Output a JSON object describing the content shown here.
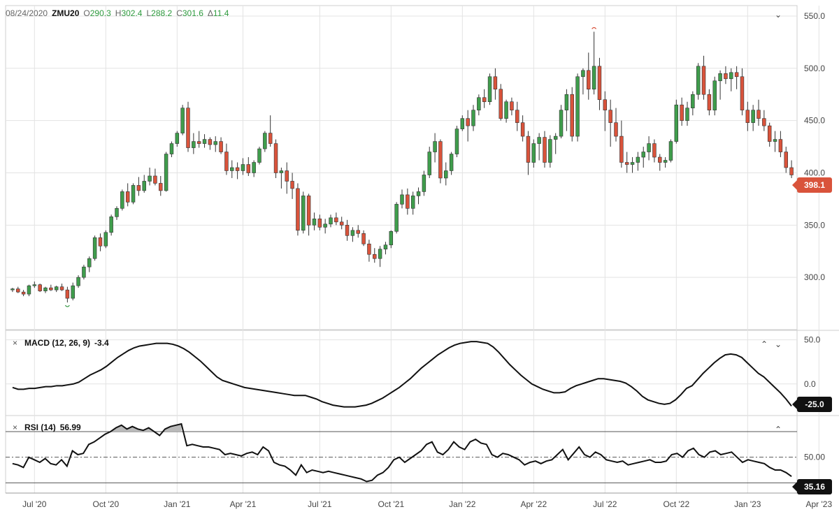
{
  "header": {
    "date": "08/24/2020",
    "symbol": "ZMU20",
    "open_label": "O",
    "open": "290.3",
    "high_label": "H",
    "high": "302.4",
    "low_label": "L",
    "low": "288.2",
    "close_label": "C",
    "close": "301.6",
    "change_label": "Δ",
    "change": "11.4"
  },
  "indicators": {
    "macd_label": "MACD (12, 26, 9)",
    "macd_value": "-3.4",
    "rsi_label": "RSI (14)",
    "rsi_value": "56.99"
  },
  "tags": {
    "last_price": "398.1",
    "macd_last": "-25.0",
    "rsi_last": "35.16"
  },
  "icons": {
    "close": "×",
    "collapse": "⌃",
    "expand": "⌄"
  },
  "colors": {
    "up": "#3f9d4c",
    "down": "#d9533b",
    "line": "#111111",
    "grid": "#e3e3e3",
    "rsi_fill": "#b9b9b9"
  },
  "chart_data": [
    {
      "type": "candlestick",
      "ylim": [
        250,
        560
      ],
      "yticks": [
        "550.0",
        "500.0",
        "450.0",
        "400.0",
        "350.0",
        "300.0"
      ],
      "ytick_values": [
        550,
        500,
        450,
        400,
        350,
        300
      ],
      "x_tick_labels": [
        "Jul '20",
        "Oct '20",
        "Jan '21",
        "Apr '21",
        "Jul '21",
        "Oct '21",
        "Jan '22",
        "Apr '22",
        "Jul '22",
        "Oct '22",
        "Jan '23",
        "Apr '23"
      ],
      "x_tick_index": [
        4,
        17,
        30,
        42,
        56,
        69,
        82,
        95,
        108,
        121,
        134,
        147
      ],
      "ohlc": [
        [
          288,
          290,
          286,
          289
        ],
        [
          289,
          291,
          285,
          286
        ],
        [
          286,
          288,
          282,
          284
        ],
        [
          284,
          293,
          282,
          292
        ],
        [
          292,
          296,
          290,
          293
        ],
        [
          293,
          294,
          286,
          287
        ],
        [
          287,
          291,
          285,
          290
        ],
        [
          290,
          293,
          287,
          288
        ],
        [
          288,
          292,
          286,
          291
        ],
        [
          291,
          294,
          287,
          288
        ],
        [
          288,
          291,
          276,
          280
        ],
        [
          280,
          295,
          278,
          292
        ],
        [
          292,
          302,
          290,
          300
        ],
        [
          300,
          312,
          298,
          310
        ],
        [
          310,
          320,
          305,
          318
        ],
        [
          318,
          340,
          316,
          338
        ],
        [
          338,
          342,
          325,
          330
        ],
        [
          330,
          345,
          328,
          343
        ],
        [
          343,
          360,
          340,
          358
        ],
        [
          358,
          368,
          355,
          366
        ],
        [
          366,
          384,
          364,
          382
        ],
        [
          382,
          390,
          368,
          372
        ],
        [
          372,
          390,
          370,
          388
        ],
        [
          388,
          396,
          378,
          383
        ],
        [
          383,
          398,
          381,
          392
        ],
        [
          392,
          405,
          388,
          397
        ],
        [
          397,
          404,
          388,
          390
        ],
        [
          390,
          397,
          378,
          383
        ],
        [
          383,
          420,
          382,
          418
        ],
        [
          418,
          430,
          415,
          428
        ],
        [
          428,
          440,
          425,
          438
        ],
        [
          438,
          465,
          436,
          462
        ],
        [
          462,
          468,
          420,
          424
        ],
        [
          424,
          438,
          418,
          430
        ],
        [
          430,
          440,
          424,
          428
        ],
        [
          428,
          437,
          424,
          432
        ],
        [
          432,
          434,
          422,
          427
        ],
        [
          427,
          435,
          420,
          430
        ],
        [
          430,
          434,
          418,
          420
        ],
        [
          420,
          428,
          398,
          402
        ],
        [
          402,
          412,
          395,
          405
        ],
        [
          405,
          410,
          394,
          402
        ],
        [
          402,
          414,
          398,
          408
        ],
        [
          408,
          415,
          397,
          400
        ],
        [
          400,
          412,
          396,
          410
        ],
        [
          410,
          425,
          408,
          423
        ],
        [
          423,
          440,
          420,
          438
        ],
        [
          438,
          455,
          425,
          428
        ],
        [
          428,
          432,
          395,
          400
        ],
        [
          400,
          405,
          385,
          402
        ],
        [
          402,
          410,
          380,
          392
        ],
        [
          392,
          400,
          375,
          385
        ],
        [
          385,
          390,
          340,
          345
        ],
        [
          345,
          382,
          342,
          378
        ],
        [
          378,
          380,
          340,
          350
        ],
        [
          350,
          362,
          345,
          356
        ],
        [
          356,
          360,
          345,
          348
        ],
        [
          348,
          356,
          342,
          351
        ],
        [
          351,
          360,
          348,
          357
        ],
        [
          357,
          362,
          350,
          353
        ],
        [
          353,
          358,
          346,
          350
        ],
        [
          350,
          355,
          335,
          340
        ],
        [
          340,
          348,
          334,
          345
        ],
        [
          345,
          350,
          338,
          342
        ],
        [
          342,
          345,
          330,
          332
        ],
        [
          332,
          336,
          315,
          322
        ],
        [
          322,
          328,
          314,
          318
        ],
        [
          318,
          330,
          310,
          327
        ],
        [
          327,
          334,
          322,
          331
        ],
        [
          331,
          345,
          328,
          344
        ],
        [
          344,
          372,
          342,
          370
        ],
        [
          370,
          384,
          366,
          379
        ],
        [
          379,
          385,
          360,
          366
        ],
        [
          366,
          382,
          360,
          378
        ],
        [
          378,
          386,
          370,
          382
        ],
        [
          382,
          402,
          378,
          398
        ],
        [
          398,
          425,
          395,
          420
        ],
        [
          420,
          438,
          410,
          430
        ],
        [
          430,
          432,
          390,
          395
        ],
        [
          395,
          410,
          388,
          402
        ],
        [
          402,
          420,
          398,
          418
        ],
        [
          418,
          445,
          415,
          442
        ],
        [
          442,
          455,
          440,
          452
        ],
        [
          452,
          460,
          430,
          445
        ],
        [
          445,
          465,
          440,
          460
        ],
        [
          460,
          475,
          455,
          472
        ],
        [
          472,
          480,
          462,
          468
        ],
        [
          468,
          495,
          465,
          492
        ],
        [
          492,
          500,
          470,
          480
        ],
        [
          480,
          485,
          450,
          452
        ],
        [
          452,
          470,
          448,
          468
        ],
        [
          468,
          472,
          455,
          460
        ],
        [
          460,
          468,
          440,
          448
        ],
        [
          448,
          455,
          430,
          435
        ],
        [
          435,
          440,
          398,
          410
        ],
        [
          410,
          432,
          405,
          428
        ],
        [
          428,
          438,
          412,
          434
        ],
        [
          434,
          440,
          405,
          410
        ],
        [
          410,
          436,
          405,
          432
        ],
        [
          432,
          438,
          418,
          435
        ],
        [
          435,
          465,
          433,
          460
        ],
        [
          460,
          480,
          440,
          475
        ],
        [
          475,
          482,
          430,
          435
        ],
        [
          435,
          495,
          430,
          492
        ],
        [
          492,
          500,
          475,
          498
        ],
        [
          498,
          515,
          470,
          480
        ],
        [
          480,
          535,
          475,
          502
        ],
        [
          502,
          510,
          460,
          470
        ],
        [
          470,
          478,
          440,
          460
        ],
        [
          460,
          470,
          425,
          448
        ],
        [
          448,
          462,
          430,
          435
        ],
        [
          435,
          450,
          405,
          410
        ],
        [
          410,
          420,
          400,
          408
        ],
        [
          408,
          415,
          400,
          410
        ],
        [
          410,
          420,
          402,
          415
        ],
        [
          415,
          425,
          405,
          420
        ],
        [
          420,
          435,
          412,
          428
        ],
        [
          428,
          432,
          410,
          415
        ],
        [
          415,
          418,
          402,
          410
        ],
        [
          410,
          415,
          405,
          412
        ],
        [
          412,
          432,
          410,
          430
        ],
        [
          430,
          470,
          428,
          465
        ],
        [
          465,
          472,
          445,
          450
        ],
        [
          450,
          468,
          445,
          462
        ],
        [
          462,
          478,
          455,
          475
        ],
        [
          475,
          505,
          470,
          502
        ],
        [
          502,
          512,
          470,
          475
        ],
        [
          475,
          480,
          455,
          460
        ],
        [
          460,
          492,
          455,
          488
        ],
        [
          488,
          498,
          470,
          495
        ],
        [
          495,
          502,
          485,
          490
        ],
        [
          490,
          500,
          478,
          496
        ],
        [
          496,
          502,
          480,
          492
        ],
        [
          492,
          500,
          455,
          460
        ],
        [
          460,
          468,
          440,
          448
        ],
        [
          448,
          465,
          440,
          460
        ],
        [
          460,
          470,
          445,
          452
        ],
        [
          452,
          460,
          440,
          445
        ],
        [
          445,
          448,
          425,
          430
        ],
        [
          430,
          440,
          420,
          432
        ],
        [
          432,
          440,
          415,
          420
        ],
        [
          420,
          425,
          400,
          405
        ],
        [
          405,
          412,
          395,
          398
        ]
      ],
      "annotations": [
        {
          "type": "low-marker",
          "index": 10
        },
        {
          "type": "high-marker",
          "index": 106
        }
      ]
    },
    {
      "type": "line",
      "name": "MACD (12, 26, 9)",
      "ylim": [
        -35,
        60
      ],
      "yticks": [
        "50.0",
        "0.0"
      ],
      "ytick_values": [
        50,
        0
      ],
      "values": [
        -4,
        -6,
        -6,
        -5,
        -5,
        -4,
        -3,
        -3,
        -2,
        -2,
        -1,
        0,
        2,
        6,
        10,
        13,
        16,
        20,
        25,
        30,
        34,
        38,
        41,
        43,
        44,
        45,
        46,
        46,
        46,
        45,
        43,
        40,
        36,
        31,
        26,
        20,
        14,
        8,
        4,
        2,
        0,
        -2,
        -4,
        -5,
        -6,
        -7,
        -8,
        -9,
        -10,
        -11,
        -12,
        -13,
        -13,
        -13,
        -15,
        -17,
        -20,
        -22,
        -24,
        -25,
        -26,
        -26,
        -26,
        -25,
        -24,
        -22,
        -19,
        -16,
        -12,
        -8,
        -4,
        1,
        6,
        12,
        18,
        23,
        28,
        33,
        37,
        41,
        44,
        46,
        47,
        48,
        48,
        47,
        46,
        42,
        36,
        29,
        22,
        16,
        10,
        5,
        0,
        -3,
        -6,
        -8,
        -10,
        -10,
        -9,
        -5,
        -2,
        0,
        2,
        4,
        6,
        6,
        5,
        4,
        3,
        1,
        -3,
        -8,
        -14,
        -18,
        -20,
        -22,
        -23,
        -22,
        -18,
        -12,
        -5,
        -2,
        5,
        12,
        18,
        24,
        29,
        33,
        34,
        33,
        30,
        24,
        18,
        12,
        8,
        2,
        -4,
        -10,
        -17,
        -25
      ]
    },
    {
      "type": "line",
      "name": "RSI (14)",
      "ylim": [
        22,
        82
      ],
      "yticks": [
        "50.00"
      ],
      "ytick_values": [
        50
      ],
      "overbought": 70,
      "oversold": 30,
      "values": [
        45,
        44,
        42,
        50,
        48,
        46,
        49,
        45,
        44,
        48,
        43,
        55,
        52,
        53,
        60,
        62,
        65,
        68,
        70,
        73,
        75,
        72,
        74,
        72,
        71,
        73,
        70,
        67,
        72,
        74,
        75,
        76,
        59,
        60,
        59,
        58,
        58,
        57,
        56,
        52,
        53,
        52,
        51,
        53,
        54,
        52,
        58,
        55,
        46,
        44,
        43,
        40,
        36,
        44,
        38,
        40,
        39,
        38,
        39,
        38,
        37,
        36,
        35,
        34,
        33,
        31,
        32,
        36,
        38,
        42,
        48,
        50,
        46,
        49,
        52,
        55,
        60,
        62,
        54,
        52,
        56,
        62,
        58,
        56,
        62,
        64,
        61,
        60,
        52,
        50,
        53,
        52,
        50,
        48,
        44,
        46,
        47,
        45,
        47,
        48,
        52,
        56,
        48,
        53,
        58,
        52,
        50,
        54,
        52,
        48,
        47,
        46,
        47,
        44,
        45,
        46,
        47,
        48,
        46,
        46,
        47,
        52,
        53,
        50,
        55,
        57,
        52,
        50,
        54,
        55,
        52,
        53,
        54,
        50,
        46,
        48,
        47,
        46,
        45,
        42,
        40,
        40,
        38,
        35
      ]
    }
  ]
}
